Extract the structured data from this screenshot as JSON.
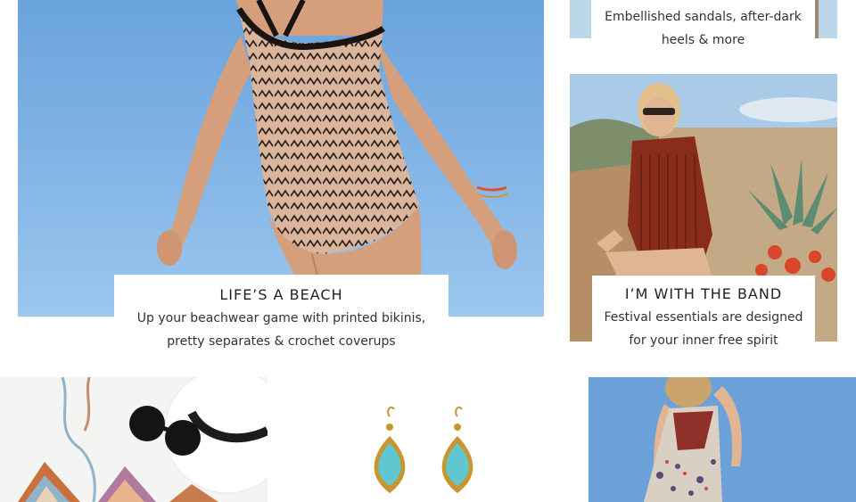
{
  "tiles": {
    "hero": {
      "image_alt": "model in printed one-piece swimsuit",
      "title": "LIFE’S A BEACH",
      "subtitle_line1": "Up your beachwear game with printed bikinis,",
      "subtitle_line2": "pretty separates & crochet coverups"
    },
    "sandals": {
      "subtitle_line1": "Embellished sandals, after-dark",
      "subtitle_line2": "heels & more"
    },
    "band": {
      "image_alt": "woman in fringe vest with sunglasses among succulents",
      "title": "I’M WITH THE BAND",
      "subtitle_line1": "Festival essentials are designed",
      "subtitle_line2": "for your inner free spirit"
    },
    "flatlay": {
      "image_alt": "printed bikini, sunglasses and hat flat lay"
    },
    "earrings": {
      "image_alt": "gold and turquoise drop earrings"
    },
    "dress": {
      "image_alt": "model in printed slip dress"
    }
  },
  "colors": {
    "sky": "#7aaee2",
    "swimsuit": "#d9b59c",
    "swimsuit_pattern": "#2a1d18",
    "skin": "#d69f7c",
    "turquoise": "#5fc7d0",
    "gold": "#c8962e",
    "fringe": "#8a2c1c"
  }
}
